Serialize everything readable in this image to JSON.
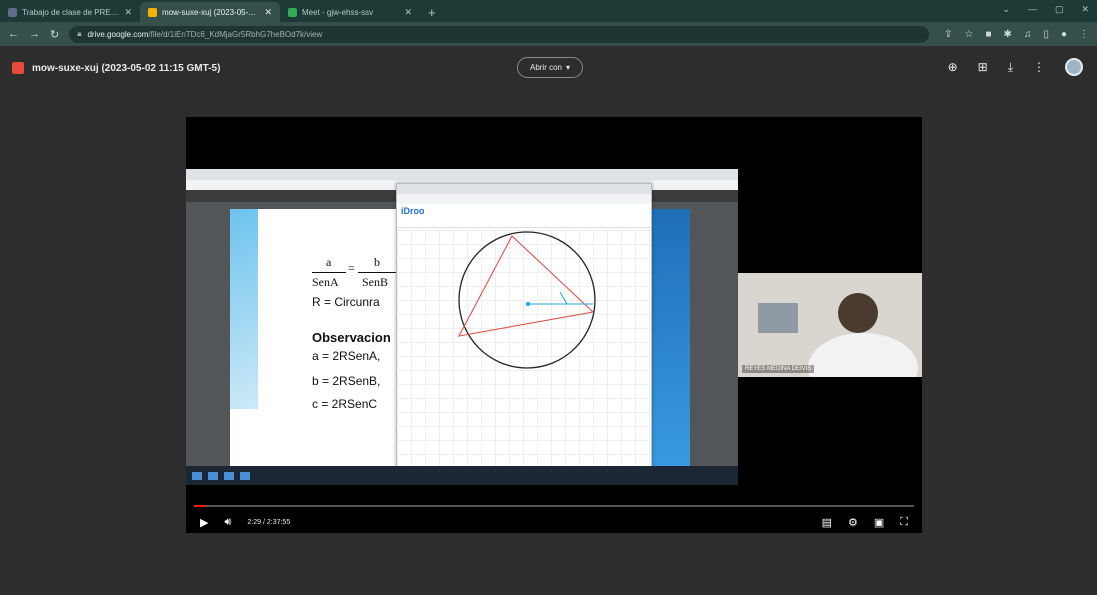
{
  "browser": {
    "tabs": [
      {
        "title": "Trabajo de clase de PREAZG-CA",
        "active": false,
        "color": "#5f6b87"
      },
      {
        "title": "mow-suxe-xuj (2023-05-02 11:",
        "active": true,
        "color": "#f4b400"
      },
      {
        "title": "Meet - gjw-ehss-ssv",
        "active": false,
        "color": "#34a853"
      }
    ],
    "new_tab_icon": "plus-icon",
    "address": {
      "host": "drive.google.com",
      "path": "/file/d/1iEnTDc6_KdMjaGr5RbhG7heBOd7k/view"
    }
  },
  "viewer": {
    "file_title": "mow-suxe-xuj (2023-05-02 11:15 GMT-5)",
    "open_with_label": "Abrir con",
    "accent": "#e64a3b"
  },
  "slide": {
    "frac_num_a": "a",
    "frac_num_b": "b",
    "frac_den_a": "SenA",
    "frac_den_b": "SenB",
    "equals": "=",
    "r_line": "R  = Circunra",
    "heading": "Observacion",
    "eq1": "a = 2RSenA,",
    "eq2": "b = 2RSenB,",
    "eq3": "c = 2RSenC",
    "app_logo": "iDroo"
  },
  "camera": {
    "participant": "REYES MEDINA DEIVIS"
  },
  "player": {
    "time": "2:29 / 2:37:55",
    "progress": 0.016
  }
}
